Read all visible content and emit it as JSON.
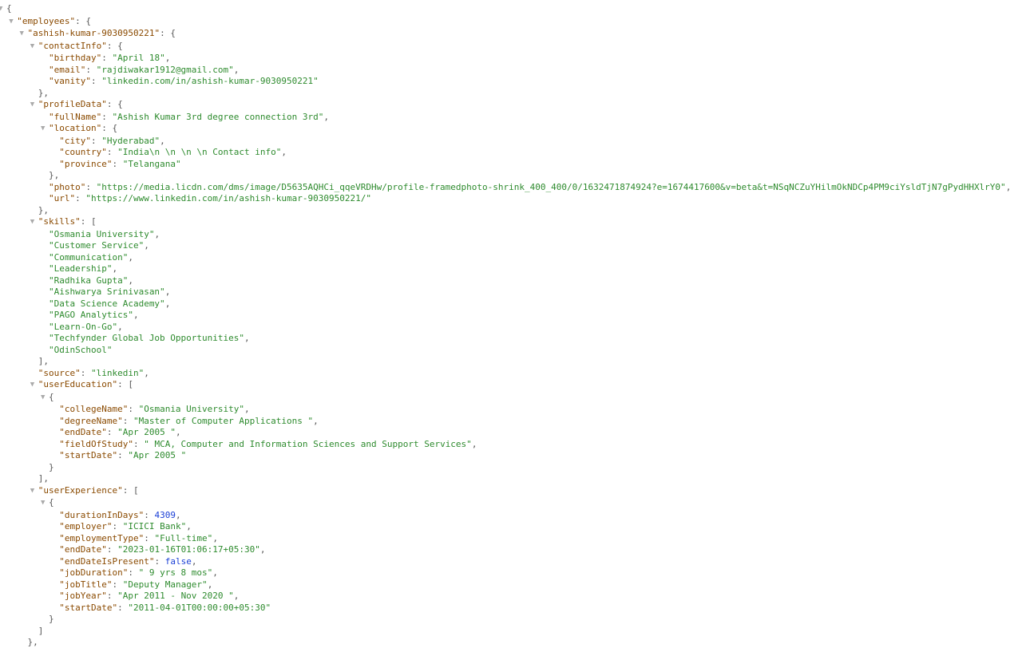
{
  "caret": "▼",
  "ind": "  ",
  "q": "\"",
  "json": {
    "open_brace": "{",
    "close_brace": "}",
    "open_bracket": "[",
    "close_bracket": "]",
    "colon": ": ",
    "comma": ","
  },
  "d": {
    "employees_key": "employees",
    "emp_id_key": "ashish-kumar-9030950221",
    "contactInfo_key": "contactInfo",
    "contactInfo": {
      "birthday_key": "birthday",
      "birthday": "April 18",
      "email_key": "email",
      "email": "rajdiwakar1912@gmail.com",
      "vanity_key": "vanity",
      "vanity": "linkedin.com/in/ashish-kumar-9030950221"
    },
    "profileData_key": "profileData",
    "profileData": {
      "fullName_key": "fullName",
      "fullName": "Ashish Kumar 3rd degree connection 3rd",
      "location_key": "location",
      "location": {
        "city_key": "city",
        "city": "Hyderabad",
        "country_key": "country",
        "country": "India\\n        \\n      \\n        \\n          Contact info",
        "province_key": "province",
        "province": "Telangana"
      },
      "photo_key": "photo",
      "photo": "https://media.licdn.com/dms/image/D5635AQHCi_qqeVRDHw/profile-framedphoto-shrink_400_400/0/1632471874924?e=1674417600&v=beta&t=NSqNCZuYHilmOkNDCp4PM9ciYsldTjN7gPydHHXlrY0",
      "url_key": "url",
      "url": "https://www.linkedin.com/in/ashish-kumar-9030950221/"
    },
    "skills_key": "skills",
    "skills": [
      "Osmania University",
      "Customer Service",
      "Communication",
      "Leadership",
      "Radhika Gupta",
      "Aishwarya Srinivasan",
      "Data Science Academy",
      "PAGO Analytics",
      "Learn-On-Go",
      "Techfynder Global Job Opportunities",
      "OdinSchool"
    ],
    "source_key": "source",
    "source": "linkedin",
    "userEducation_key": "userEducation",
    "userEducation": {
      "collegeName_key": "collegeName",
      "collegeName": "Osmania University",
      "degreeName_key": "degreeName",
      "degreeName": "Master of Computer Applications ",
      "endDate_key": "endDate",
      "endDate": "Apr 2005 ",
      "fieldOfStudy_key": "fieldOfStudy",
      "fieldOfStudy": " MCA, Computer and Information Sciences and Support Services",
      "startDate_key": "startDate",
      "startDate": "Apr 2005 "
    },
    "userExperience_key": "userExperience",
    "userExperience": {
      "durationInDays_key": "durationInDays",
      "durationInDays": 4309,
      "employer_key": "employer",
      "employer": "ICICI Bank",
      "employmentType_key": "employmentType",
      "employmentType": "Full-time",
      "endDate_key": "endDate",
      "endDate": "2023-01-16T01:06:17+05:30",
      "endDateIsPresent_key": "endDateIsPresent",
      "endDateIsPresent": false,
      "jobDuration_key": "jobDuration",
      "jobDuration": " 9 yrs 8 mos",
      "jobTitle_key": "jobTitle",
      "jobTitle": "Deputy Manager",
      "jobYear_key": "jobYear",
      "jobYear": "Apr 2011 - Nov 2020 ",
      "startDate_key": "startDate",
      "startDate": "2011-04-01T00:00:00+05:30"
    }
  }
}
